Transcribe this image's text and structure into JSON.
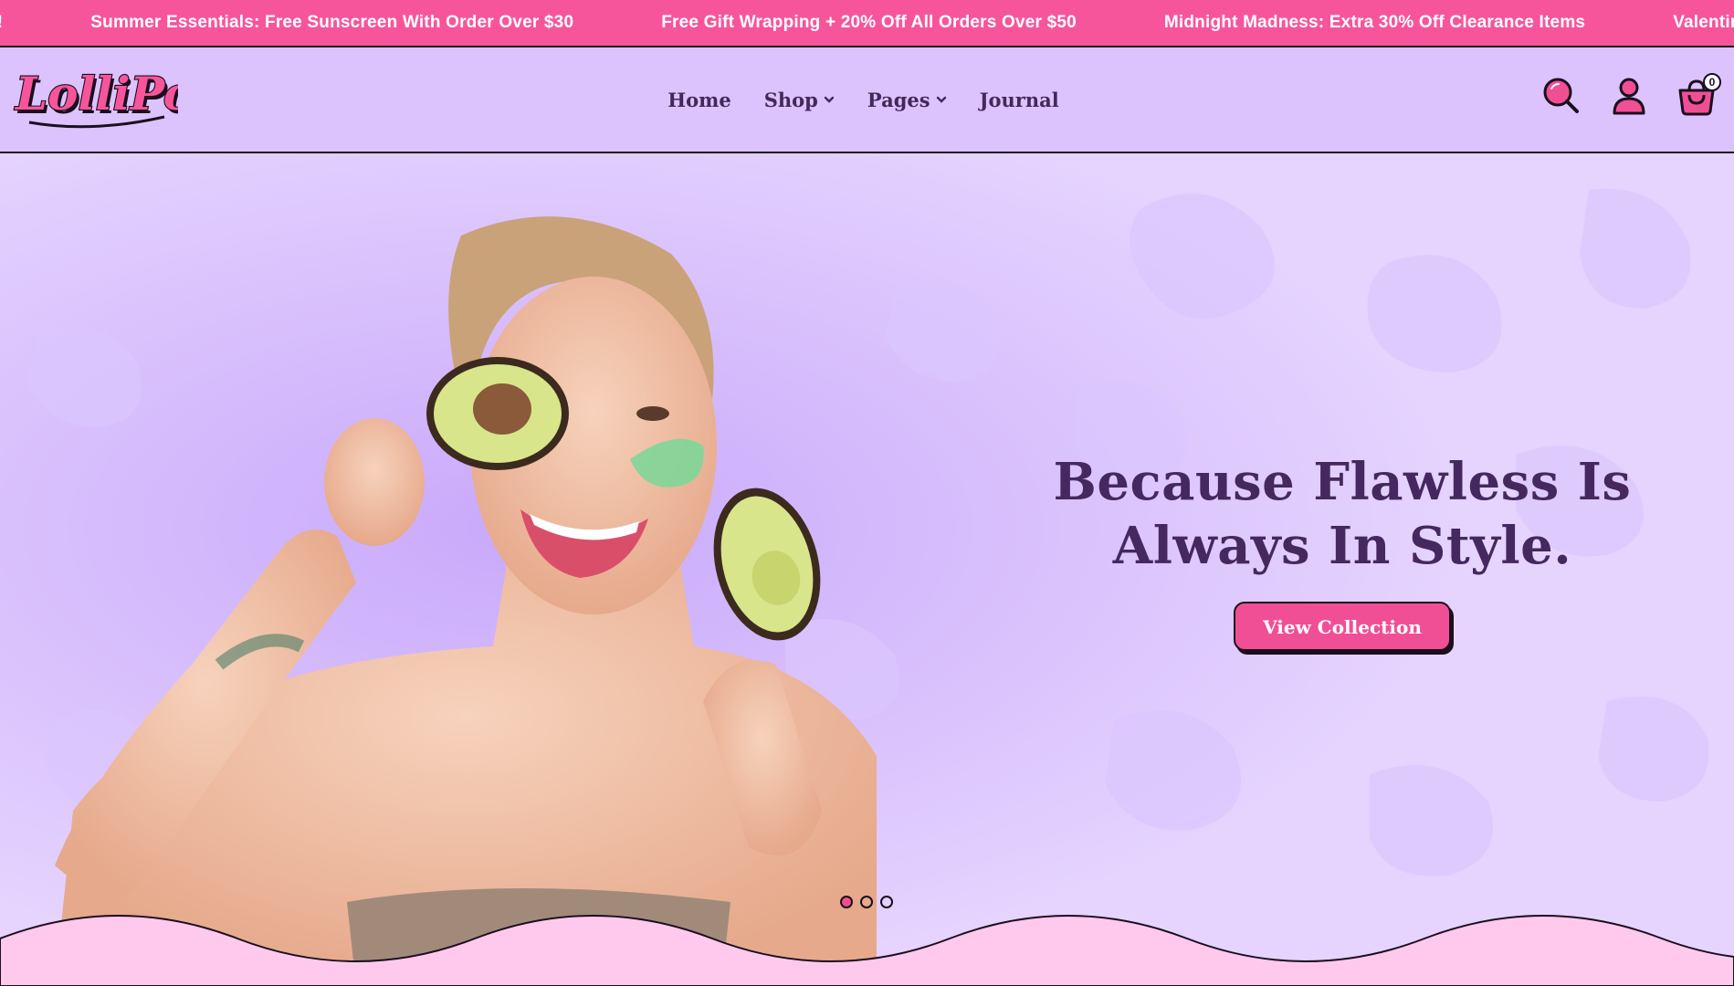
{
  "announcement": {
    "items": [
      "y!",
      "Summer Essentials: Free Sunscreen With Order Over $30",
      "Free Gift Wrapping + 20% Off All Orders Over $50",
      "Midnight Madness: Extra 30% Off Clearance Items",
      "Valentine's Sp"
    ]
  },
  "header": {
    "logo_text": "LolliPop",
    "nav": [
      {
        "label": "Home",
        "has_dropdown": false
      },
      {
        "label": "Shop",
        "has_dropdown": true
      },
      {
        "label": "Pages",
        "has_dropdown": true
      },
      {
        "label": "Journal",
        "has_dropdown": false
      }
    ],
    "icons": [
      "search-icon",
      "account-icon",
      "cart-icon"
    ],
    "cart_count": "0"
  },
  "hero": {
    "title_line1": "Because Flawless Is",
    "title_line2": "Always In Style.",
    "button_label": "View Collection",
    "slides_total": 3,
    "active_slide": 1
  },
  "colors": {
    "announcement_bg": "#f7559b",
    "header_bg": "#dcc3fe",
    "hero_bg": "#e6d4fe",
    "accent_pink": "#f14f95",
    "title_purple": "#45285f",
    "footer_wave": "#ffc9ee"
  }
}
